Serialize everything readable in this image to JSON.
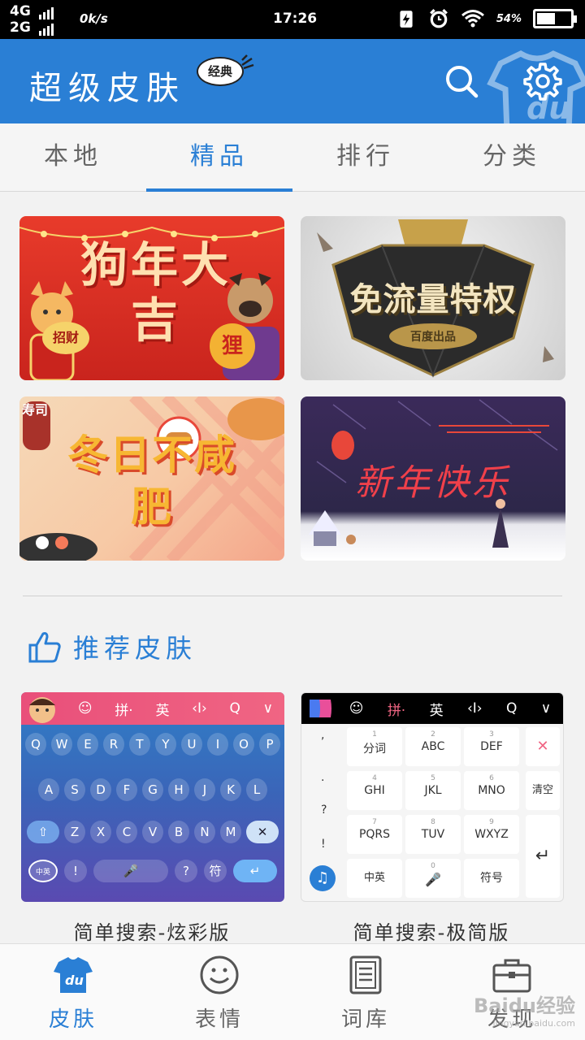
{
  "status_bar": {
    "network_1": "4G",
    "network_2": "2G",
    "speed": "0k/s",
    "time": "17:26",
    "battery": "54%",
    "battery_level": 0.54,
    "icons": [
      "charging-icon",
      "alarm-icon",
      "wifi-icon"
    ]
  },
  "header": {
    "title": "超级皮肤",
    "badge": "经典",
    "background_logo": "du",
    "actions": [
      "search-icon",
      "settings-icon"
    ]
  },
  "tabs": [
    {
      "label": "本地",
      "active": false
    },
    {
      "label": "精品",
      "active": true
    },
    {
      "label": "排行",
      "active": false
    },
    {
      "label": "分类",
      "active": false
    }
  ],
  "banners": [
    {
      "text": "狗年大吉",
      "extra_1": "招财",
      "extra_2": "狸"
    },
    {
      "text": "免流量特权",
      "extra_1": "百度出品"
    },
    {
      "text": "冬日不咸肥",
      "extra_1": "寿司"
    },
    {
      "text": "新年快乐"
    }
  ],
  "recommended": {
    "title": "推荐皮肤",
    "items": [
      {
        "caption": "简单搜索-炫彩版",
        "toolbar": [
          "☺",
          "拼·",
          "英",
          "‹I›",
          "Q",
          "∨"
        ],
        "rows": [
          [
            "Q",
            "W",
            "E",
            "R",
            "T",
            "Y",
            "U",
            "I",
            "O",
            "P"
          ],
          [
            "A",
            "S",
            "D",
            "F",
            "G",
            "H",
            "J",
            "K",
            "L"
          ],
          [
            "⇧",
            "Z",
            "X",
            "C",
            "V",
            "B",
            "N",
            "M",
            "✕"
          ]
        ],
        "bottom_row": [
          "中英",
          "!",
          "?",
          "符",
          "↵"
        ]
      },
      {
        "caption": "简单搜索-极简版",
        "toolbar": [
          "☺",
          "拼·",
          "英",
          "‹I›",
          "Q",
          "∨"
        ],
        "left_column": [
          ",",
          ".",
          "?",
          "!"
        ],
        "keys": [
          {
            "num": "1",
            "label": "分词"
          },
          {
            "num": "2",
            "label": "ABC"
          },
          {
            "num": "3",
            "label": "DEF"
          },
          {
            "num": "4",
            "label": "GHI"
          },
          {
            "num": "5",
            "label": "JKL"
          },
          {
            "num": "6",
            "label": "MNO"
          },
          {
            "num": "7",
            "label": "PQRS"
          },
          {
            "num": "8",
            "label": "TUV"
          },
          {
            "num": "9",
            "label": "WXYZ"
          }
        ],
        "bottom_row": [
          "中英",
          "0",
          "符号"
        ],
        "right_column": [
          "✕",
          "清空",
          "↵"
        ]
      }
    ]
  },
  "bottom_nav": [
    {
      "label": "皮肤",
      "icon": "du-shirt-icon",
      "active": true
    },
    {
      "label": "表情",
      "icon": "smiley-icon",
      "active": false
    },
    {
      "label": "词库",
      "icon": "dictionary-icon",
      "active": false
    },
    {
      "label": "发现",
      "icon": "briefcase-icon",
      "active": false
    }
  ],
  "watermark": {
    "text": "Baidu经验",
    "sub": "jingyan.baidu.com"
  },
  "colors": {
    "primary": "#2a7fd5",
    "statusbar": "#000000",
    "background": "#f2f2f2"
  }
}
